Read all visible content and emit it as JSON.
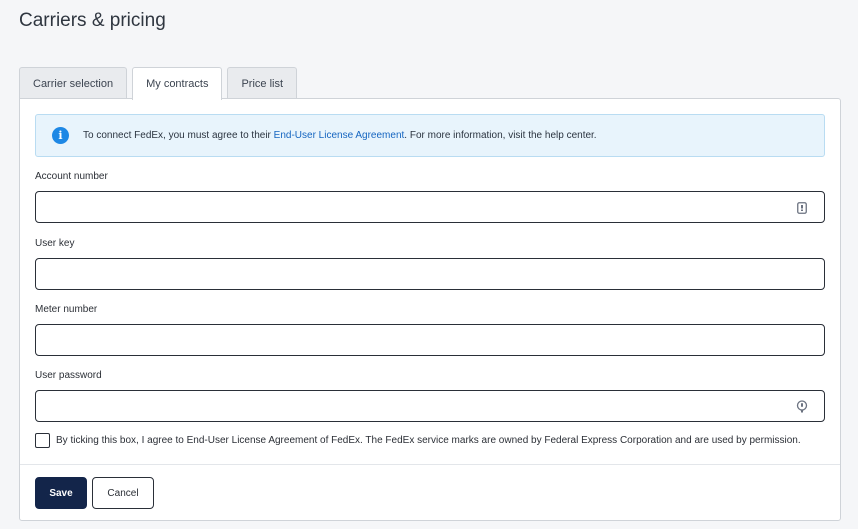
{
  "page": {
    "title": "Carriers & pricing"
  },
  "tabs": [
    {
      "label": "Carrier selection"
    },
    {
      "label": "My contracts"
    },
    {
      "label": "Price list"
    }
  ],
  "alert": {
    "prefix": "To connect FedEx, you must agree to their ",
    "link": "End-User License Agreement",
    "suffix": ". For more information, visit the help center."
  },
  "form": {
    "account_number": {
      "label": "Account number",
      "value": ""
    },
    "user_key": {
      "label": "User key",
      "value": ""
    },
    "meter_number": {
      "label": "Meter number",
      "value": ""
    },
    "user_password": {
      "label": "User password",
      "value": ""
    }
  },
  "agreement": {
    "text": "By ticking this box, I agree to End-User License Agreement of FedEx. The FedEx service marks are owned by Federal Express Corporation and are used by permission.",
    "checked": false
  },
  "actions": {
    "save": "Save",
    "cancel": "Cancel"
  },
  "icons": {
    "info": "info-icon",
    "account_field": "password-manager-icon",
    "password_field": "password-manager-key-icon"
  },
  "colors": {
    "primary": "#13254a",
    "info": "#1e88e5",
    "link": "#1565c0"
  }
}
